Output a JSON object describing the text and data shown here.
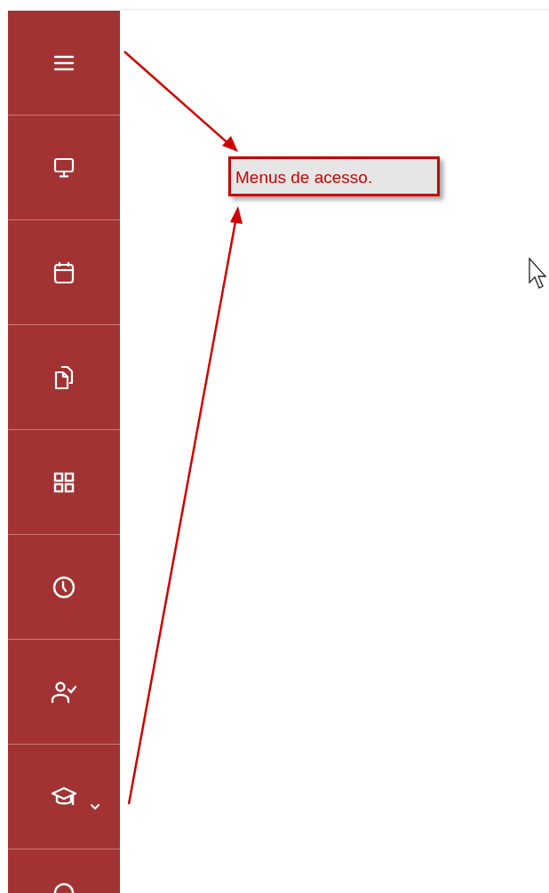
{
  "sidebar": {
    "items": [
      {
        "kind": "menu",
        "expandable": false
      },
      {
        "kind": "monitor",
        "expandable": false
      },
      {
        "kind": "calendar",
        "expandable": false
      },
      {
        "kind": "files",
        "expandable": false
      },
      {
        "kind": "grid",
        "expandable": false
      },
      {
        "kind": "clock",
        "expandable": false
      },
      {
        "kind": "user-check",
        "expandable": false
      },
      {
        "kind": "graduation",
        "expandable": true
      },
      {
        "kind": "partial"
      }
    ]
  },
  "callout": {
    "text": "Menus de acesso."
  }
}
